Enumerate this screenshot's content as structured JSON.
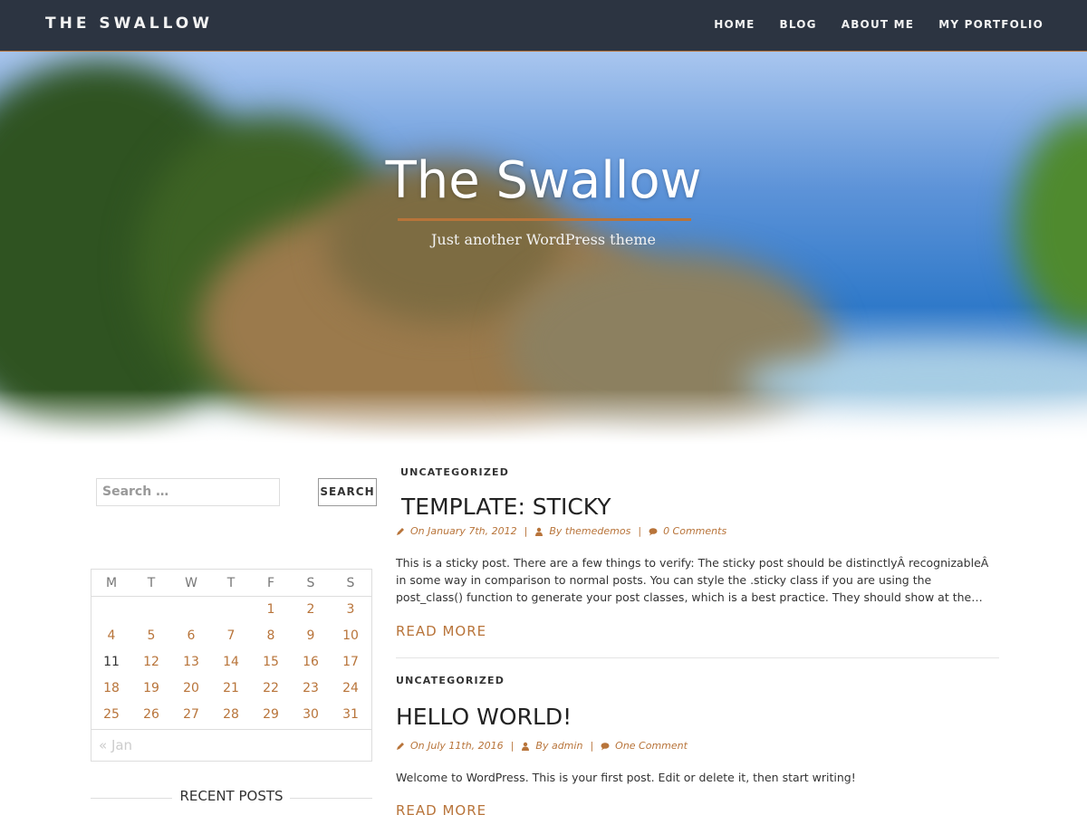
{
  "header": {
    "brand": "THE SWALLOW",
    "nav": [
      "HOME",
      "BLOG",
      "ABOUT ME",
      "MY PORTFOLIO"
    ]
  },
  "hero": {
    "title": "The Swallow",
    "tagline": "Just another WordPress theme"
  },
  "sidebar": {
    "search": {
      "placeholder": "Search …",
      "button": "SEARCH"
    },
    "calendar": {
      "weekdays": [
        "M",
        "T",
        "W",
        "T",
        "F",
        "S",
        "S"
      ],
      "weeks": [
        [
          "",
          "",
          "",
          "",
          "1",
          "2",
          "3"
        ],
        [
          "4",
          "5",
          "6",
          "7",
          "8",
          "9",
          "10"
        ],
        [
          "11",
          "12",
          "13",
          "14",
          "15",
          "16",
          "17"
        ],
        [
          "18",
          "19",
          "20",
          "21",
          "22",
          "23",
          "24"
        ],
        [
          "25",
          "26",
          "27",
          "28",
          "29",
          "30",
          "31"
        ]
      ],
      "today": "11",
      "prev_link": "« Jan"
    },
    "recent_posts_title": "RECENT POSTS"
  },
  "posts": [
    {
      "category": "UNCATEGORIZED",
      "title": "TEMPLATE: STICKY",
      "date": "On January 7th, 2012",
      "author": "By themedemos",
      "comments": "0 Comments",
      "excerpt": "This is a sticky post. There are a few things to verify: The sticky post should be distinctlyÂ recognizableÂ in some way in comparison to normal posts. You can style the .sticky class if you are using the post_class() function to generate your post classes, which is a best practice. They should show at the…",
      "read_more": "READ MORE"
    },
    {
      "category": "UNCATEGORIZED",
      "title": "HELLO WORLD!",
      "date": "On July 11th, 2016",
      "author": "By admin",
      "comments": "One Comment",
      "excerpt": "Welcome to WordPress. This is your first post. Edit or delete it, then start writing!",
      "read_more": "READ MORE"
    }
  ],
  "colors": {
    "accent": "#b8743a",
    "nav_bg": "#2c3441"
  },
  "icons": [
    "pencil-icon",
    "user-icon",
    "comment-icon"
  ]
}
